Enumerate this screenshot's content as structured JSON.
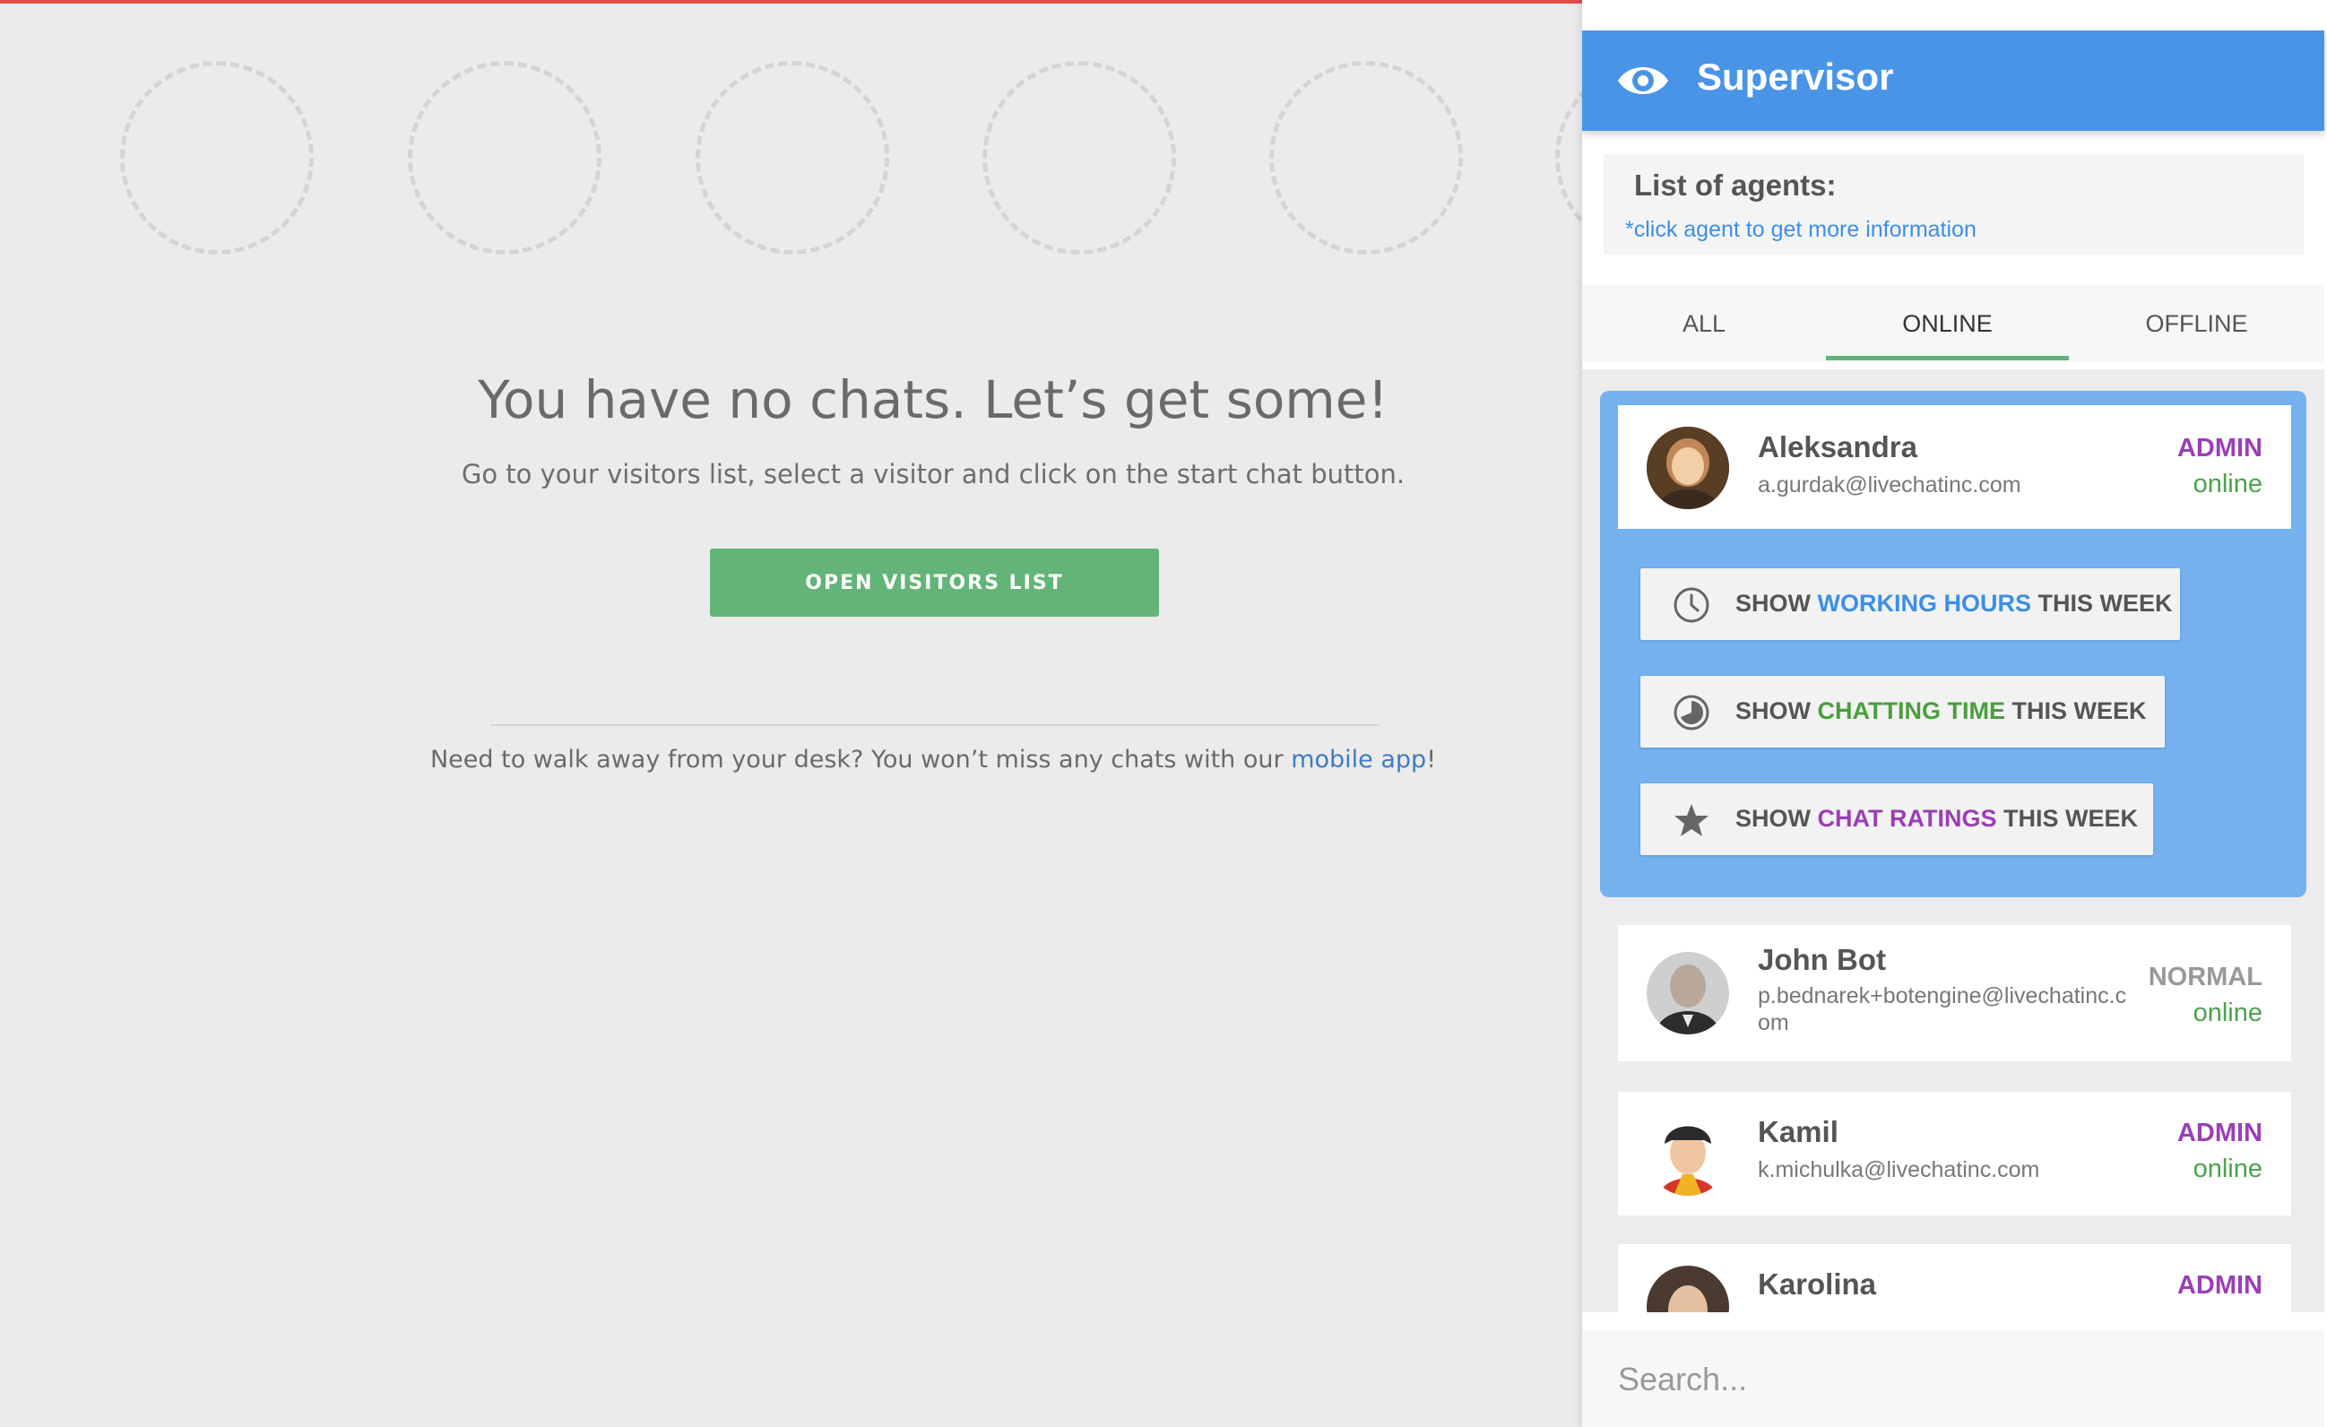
{
  "main": {
    "empty_title": "You have no chats. Let’s get some!",
    "empty_subtitle": "Go to your visitors list, select a visitor and click on the start chat button.",
    "open_visitors_label": "OPEN VISITORS LIST",
    "footer_text": "Need to walk away from your desk? You won’t miss any chats with our ",
    "footer_link": "mobile app",
    "footer_end": "!"
  },
  "panel": {
    "title": "Supervisor",
    "title_icon": "eye-icon",
    "header_color": "#4a94e8",
    "agents_heading": "List of agents:",
    "agents_hint": "*click agent to get more information",
    "tabs": [
      {
        "label": "ALL",
        "active": false
      },
      {
        "label": "ONLINE",
        "active": true
      },
      {
        "label": "OFFLINE",
        "active": false
      }
    ],
    "actions": [
      {
        "icon": "clock-icon",
        "prefix": "SHOW ",
        "highlight": "WORKING HOURS",
        "suffix": " THIS WEEK",
        "color": "#3c8fe6"
      },
      {
        "icon": "chat-time-icon",
        "prefix": "SHOW ",
        "highlight": "CHATTING TIME",
        "suffix": " THIS WEEK",
        "color": "#4a9e3e"
      },
      {
        "icon": "star-icon",
        "prefix": "SHOW ",
        "highlight": "CHAT RATINGS",
        "suffix": " THIS WEEK",
        "color": "#9b3fb5"
      }
    ],
    "agents": [
      {
        "name": "Aleksandra",
        "email": "a.gurdak@livechatinc.com",
        "role": "ADMIN",
        "status": "online"
      },
      {
        "name": "John Bot",
        "email": "p.bednarek+botengine@livechatinc.c",
        "email_wrap": "om",
        "role": "NORMAL",
        "status": "online"
      },
      {
        "name": "Kamil",
        "email": "k.michulka@livechatinc.com",
        "role": "ADMIN",
        "status": "online"
      },
      {
        "name": "Karolina",
        "email": "",
        "role": "ADMIN",
        "status": ""
      }
    ],
    "search_placeholder": "Search..."
  },
  "colors": {
    "accent_green": "#63b477",
    "admin_purple": "#9b3fb5",
    "online_green": "#4aa34a",
    "expanded_blue": "#74b1ee"
  }
}
